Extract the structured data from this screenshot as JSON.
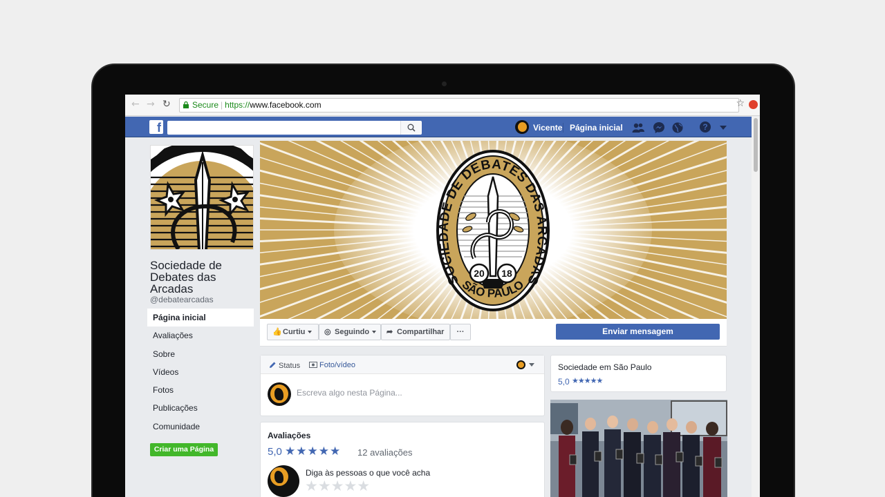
{
  "browser": {
    "secure_label": "Secure",
    "url_scheme": "https://",
    "url_host": "www.facebook.com"
  },
  "fb_header": {
    "user_name": "Vicente",
    "home_label": "Página inicial",
    "help_glyph": "?"
  },
  "page": {
    "name": "Sociedade de Debates das Arcadas",
    "handle": "@debatearcadas",
    "nav": [
      {
        "label": "Página inicial",
        "active": true
      },
      {
        "label": "Avaliações"
      },
      {
        "label": "Sobre"
      },
      {
        "label": "Vídeos"
      },
      {
        "label": "Fotos"
      },
      {
        "label": "Publicações"
      },
      {
        "label": "Comunidade"
      }
    ],
    "create_page_label": "Criar uma Página"
  },
  "cover": {
    "emblem_top_text": "SOCIEDADE DE DEBATES DAS ARCADAS",
    "emblem_bottom_text": "SÃO PAULO",
    "emblem_year_left": "20",
    "emblem_year_right": "18",
    "accent_color": "#c9a55b"
  },
  "actions": {
    "like_label": "Curtiu",
    "follow_label": "Seguindo",
    "share_label": "Compartilhar",
    "more_label": "···",
    "send_message_label": "Enviar mensagem"
  },
  "composer": {
    "status_tab": "Status",
    "photo_tab": "Foto/vídeo",
    "placeholder": "Escreva algo nesta Página..."
  },
  "reviews": {
    "title": "Avaliações",
    "score": "5,0",
    "stars": "★★★★★",
    "count_label": "12 avaliações",
    "prompt": "Diga às pessoas o que você acha",
    "empty_stars": "★★★★★"
  },
  "location_card": {
    "title": "Sociedade em São Paulo",
    "score": "5,0",
    "stars": "★★★★★"
  },
  "colors": {
    "fb_blue": "#4267b2",
    "green": "#42b72a",
    "gold": "#c9a55b"
  }
}
